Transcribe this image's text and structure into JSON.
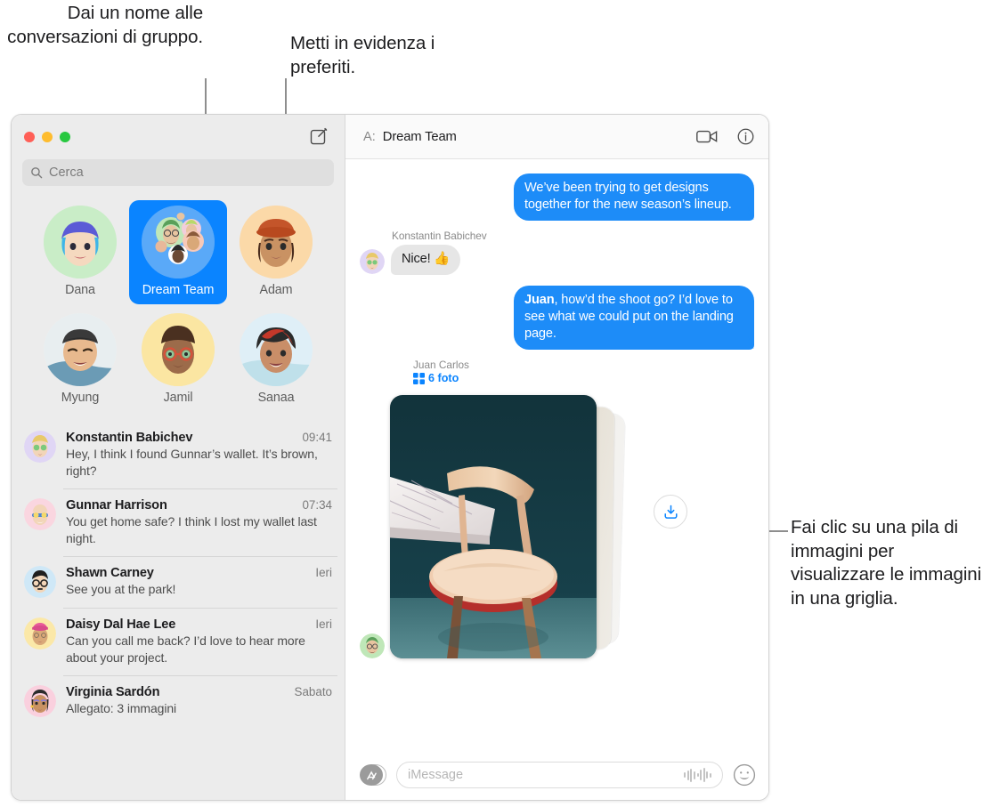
{
  "callouts": [
    {
      "id": "group-name",
      "text": "Dai un nome alle conversazioni di gruppo."
    },
    {
      "id": "favorites",
      "text": "Metti in evidenza i preferiti."
    },
    {
      "id": "photo-stack",
      "text": "Fai clic su una pila di immagini per visualizzare le immagini in una griglia."
    }
  ],
  "colors": {
    "accent_blue": "#0a84ff",
    "bubble_blue": "#1d8cf8",
    "bubble_gray": "#e6e6e6",
    "sidebar_bg": "#ececec",
    "traffic_red": "#ff5f57",
    "traffic_yellow": "#febc2e",
    "traffic_green": "#28c840"
  },
  "window": {
    "traffic_lights": [
      "close",
      "minimize",
      "zoom"
    ],
    "compose_icon": "compose-icon"
  },
  "search": {
    "placeholder": "Cerca",
    "value": "",
    "icon": "search-icon"
  },
  "pinned": [
    {
      "name": "Dana",
      "selected": false,
      "avatar_bg": "#c9edc7"
    },
    {
      "name": "Dream Team",
      "selected": true,
      "avatar_bg": "#5aa9f8"
    },
    {
      "name": "Adam",
      "selected": false,
      "avatar_bg": "#fbd9a8"
    },
    {
      "name": "Myung",
      "selected": false,
      "avatar_bg": "#f2f2ef"
    },
    {
      "name": "Jamil",
      "selected": false,
      "avatar_bg": "#fbe6a2"
    },
    {
      "name": "Sanaa",
      "selected": false,
      "avatar_bg": "#dfeff7"
    }
  ],
  "conversations": [
    {
      "name": "Konstantin Babichev",
      "time": "09:41",
      "preview": "Hey, I think I found Gunnar’s wallet. It’s brown, right?",
      "avatar_bg": "#e0d6f5"
    },
    {
      "name": "Gunnar Harrison",
      "time": "07:34",
      "preview": "You get home safe? I think I lost my wallet last night.",
      "avatar_bg": "#fad6e0"
    },
    {
      "name": "Shawn Carney",
      "time": "Ieri",
      "preview": "See you at the park!",
      "avatar_bg": "#cfe8f7"
    },
    {
      "name": "Daisy Dal Hae Lee",
      "time": "Ieri",
      "preview": "Can you call me back? I’d love to hear more about your project.",
      "avatar_bg": "#fbe8a8"
    },
    {
      "name": "Virginia Sardón",
      "time": "Sabato",
      "preview": "Allegato:  3 immagini",
      "avatar_bg": "#fad0de"
    }
  ],
  "conversation_header": {
    "to_label": "A:",
    "to_name": "Dream Team",
    "facetime_icon": "video-camera-icon",
    "info_icon": "info-circle-icon"
  },
  "messages": [
    {
      "type": "outgoing",
      "text": "We’ve been trying to get designs together for the new season’s lineup."
    },
    {
      "type": "incoming",
      "sender": "Konstantin Babichev",
      "text": "Nice!  👍"
    },
    {
      "type": "outgoing",
      "bold_prefix": "Juan",
      "text": ", how’d the shoot go? I’d love to see what we could put on the landing page."
    }
  ],
  "photo_stack": {
    "sender": "Juan Carlos",
    "count_label": "6 foto",
    "grid_icon": "grid-icon",
    "download_icon": "download-icon"
  },
  "composer": {
    "apps_icon": "app-store-icon",
    "placeholder": "iMessage",
    "value": "",
    "audio_icon": "audio-waveform-icon",
    "emoji_icon": "smiley-face-icon"
  }
}
